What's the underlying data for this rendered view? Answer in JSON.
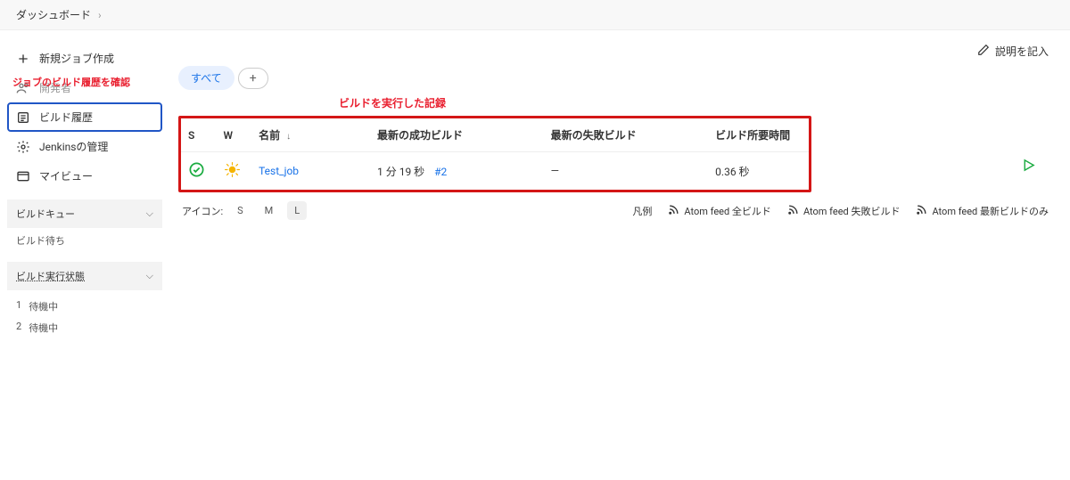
{
  "breadcrumb": {
    "root": "ダッシュボード"
  },
  "sidebar": {
    "new_job": "新規ジョブ作成",
    "people": "開発者",
    "history": "ビルド履歴",
    "manage": "Jenkinsの管理",
    "my_view": "マイビュー"
  },
  "annotations": {
    "history_note": "ジョブのビルド履歴を確認",
    "table_note": "ビルドを実行した記録"
  },
  "queue": {
    "header": "ビルドキュー",
    "empty": "ビルド待ち"
  },
  "executors": {
    "header": "ビルド実行状態",
    "items": [
      {
        "num": "1",
        "state": "待機中"
      },
      {
        "num": "2",
        "state": "待機中"
      }
    ]
  },
  "content": {
    "desc_link": "説明を記入",
    "tab_all": "すべて"
  },
  "table": {
    "headers": {
      "s": "S",
      "w": "W",
      "name": "名前",
      "last_success": "最新の成功ビルド",
      "last_fail": "最新の失敗ビルド",
      "duration": "ビルド所要時間"
    },
    "rows": [
      {
        "name": "Test_job",
        "success_time": "1 分 19 秒",
        "success_ref": "#2",
        "fail": "—",
        "duration": "0.36 秒"
      }
    ]
  },
  "footer": {
    "icon_label": "アイコン:",
    "sizes": {
      "s": "S",
      "m": "M",
      "l": "L"
    },
    "legend": "凡例",
    "feed_all": "Atom feed 全ビルド",
    "feed_fail": "Atom feed 失敗ビルド",
    "feed_latest": "Atom feed 最新ビルドのみ"
  }
}
